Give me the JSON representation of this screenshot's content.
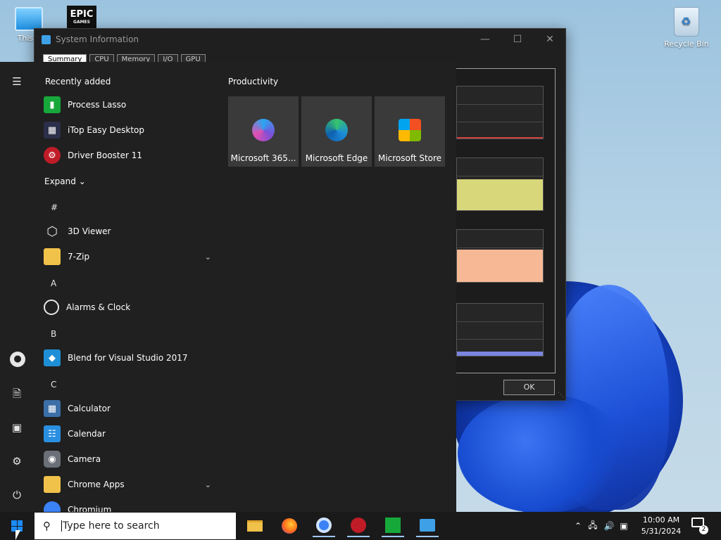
{
  "desktop": {
    "icons": [
      {
        "label": "This P",
        "icon": "computer-icon"
      },
      {
        "label": "",
        "icon": "epic-games-icon",
        "logo_text": "EPIC",
        "logo_sub": "GAMES"
      },
      {
        "label": "Recycle Bin",
        "icon": "recycle-bin-icon"
      }
    ]
  },
  "sysinfo": {
    "title": "System Information",
    "tabs": [
      "Summary",
      "CPU",
      "Memory",
      "I/O",
      "GPU"
    ],
    "active_tab": "Summary",
    "ok_label": "OK",
    "graph_colors": [
      "#d04040",
      "#d8d77a",
      "#f7b995",
      "#7a86e0"
    ]
  },
  "start_menu": {
    "recently_added_title": "Recently added",
    "recent": [
      {
        "label": "Process Lasso",
        "icon": "process-lasso-icon",
        "color": "#17a83b"
      },
      {
        "label": "iTop Easy Desktop",
        "icon": "itop-easy-desktop-icon",
        "color": "#2b2f4a"
      },
      {
        "label": "Driver Booster 11",
        "icon": "driver-booster-icon",
        "color": "#c01c28"
      }
    ],
    "expand_label": "Expand",
    "groups": [
      {
        "letter": "#",
        "apps": [
          {
            "label": "3D Viewer",
            "icon": "3d-viewer-icon",
            "chevron": false
          },
          {
            "label": "7-Zip",
            "icon": "folder-icon",
            "chevron": true
          }
        ]
      },
      {
        "letter": "A",
        "apps": [
          {
            "label": "Alarms & Clock",
            "icon": "alarm-clock-icon",
            "chevron": false
          }
        ]
      },
      {
        "letter": "B",
        "apps": [
          {
            "label": "Blend for Visual Studio 2017",
            "icon": "blend-icon",
            "chevron": false
          }
        ]
      },
      {
        "letter": "C",
        "apps": [
          {
            "label": "Calculator",
            "icon": "calculator-icon",
            "chevron": false
          },
          {
            "label": "Calendar",
            "icon": "calendar-icon",
            "chevron": false
          },
          {
            "label": "Camera",
            "icon": "camera-icon",
            "chevron": false
          },
          {
            "label": "Chrome Apps",
            "icon": "folder-icon",
            "chevron": true
          },
          {
            "label": "Chromium",
            "icon": "chromium-icon",
            "chevron": false
          }
        ]
      }
    ],
    "productivity_title": "Productivity",
    "tiles": [
      {
        "label": "Microsoft 365...",
        "icon": "microsoft-365-icon"
      },
      {
        "label": "Microsoft Edge",
        "icon": "edge-icon"
      },
      {
        "label": "Microsoft Store",
        "icon": "store-icon"
      }
    ],
    "rail": [
      "hamburger-icon",
      "user-icon",
      "documents-icon",
      "pictures-icon",
      "settings-icon",
      "power-icon"
    ]
  },
  "taskbar": {
    "search_placeholder": "Type here to search",
    "apps": [
      "file-explorer-icon",
      "firefox-icon",
      "chromium-icon",
      "driver-booster-icon",
      "process-lasso-icon",
      "system-information-icon"
    ],
    "clock_time": "10:00 AM",
    "clock_date": "5/31/2024",
    "notification_count": "2"
  }
}
